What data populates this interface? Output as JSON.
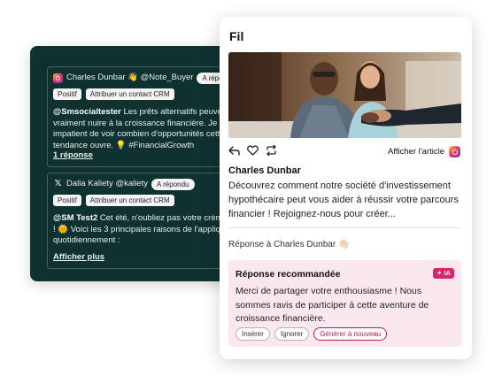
{
  "inbox": {
    "messages": [
      {
        "network_icon": "instagram-icon",
        "header": "Charles Dunbar 👋 @Note_Buyer",
        "status": "A répondu",
        "tags": [
          "Positif",
          "Attribuer un contact CRM"
        ],
        "handle": "@Smsocialtester",
        "text": " Les prêts alternatifs peuvent vraiment nuire à la croissance financière. Je suis impatient de voir combien d'opportunités cette tendance ouvre. 💡 #FinancialGrowth",
        "link": "1 réponse"
      },
      {
        "network_icon": "x-icon",
        "header": "Dalia Kaliety @kaliety",
        "status": "A répondu",
        "tags": [
          "Positif",
          "Attribuer un contact CRM"
        ],
        "handle": "@SM Test2",
        "text": " Cet été, n'oubliez pas votre crème solaire ! 🌞 Voici les 3 principales raisons de l'appliquer quotidiennement :",
        "link": "Afficher plus"
      }
    ]
  },
  "feed": {
    "title": "Fil",
    "view_article": "Afficher l'article",
    "author": "Charles Dunbar",
    "post_text": "Découvrez comment notre société d'investissement hypothécaire peut vous aider à réussir votre parcours financier ! Rejoignez-nous pour créer...",
    "reply_to": "Réponse à Charles Dunbar 👋🏻",
    "recommended": {
      "title": "Réponse recommandée",
      "badge": "✦ IA",
      "text": "Merci de partager votre enthousiasme ! Nous sommes ravis de participer à cette aventure de croissance financière.",
      "buttons": {
        "insert": "Insérer",
        "ignore": "Ignorer",
        "regenerate": "Générer à nouveau"
      }
    }
  },
  "colors": {
    "inbox_bg": "#0f3130",
    "accent_pink": "#e0226d",
    "recommend_bg": "#fbe8ef"
  }
}
